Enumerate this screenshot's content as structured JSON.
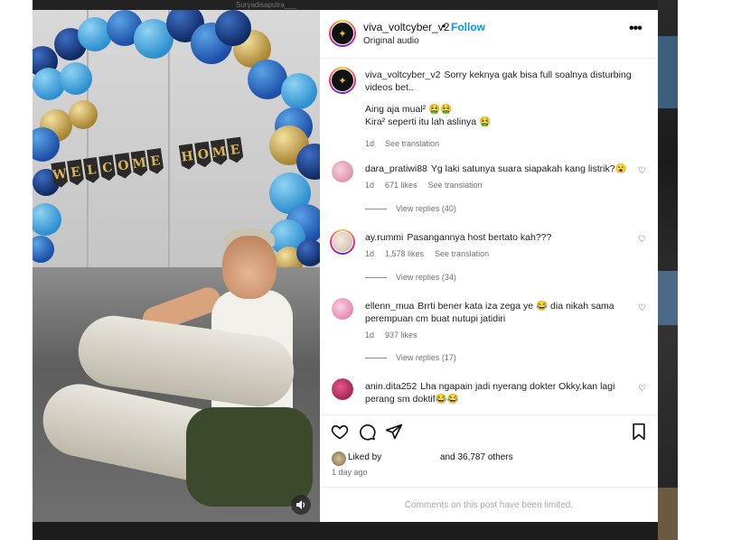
{
  "top_strip": {
    "faint_text": "Suryadisaputra___"
  },
  "post": {
    "author": "viva_voltcyber_v2",
    "follow_label": "Follow",
    "separator": "•",
    "audio_label": "Original audio",
    "more_icon": "more-options-icon"
  },
  "caption": {
    "username": "viva_voltcyber_v2",
    "line1": "Sorry keknya gak bisa full soalnya disturbing videos bet..",
    "line2": "Aing aja mual² 🤮🤮",
    "line3": "Kira² seperti itu lah aslinya 🤮",
    "time": "1d",
    "translate": "See translation"
  },
  "comments": [
    {
      "username": "dara_pratiwi88",
      "text": "Yg laki satunya suara siapakah kang listrik?😮",
      "time": "1d",
      "likes": "671 likes",
      "translate": "See translation",
      "replies": "View replies (40)",
      "avatar_color": "#f1a8b8"
    },
    {
      "username": "ay.rummi",
      "text": "Pasangannya host bertato kah???",
      "time": "1d",
      "likes": "1,578 likes",
      "translate": "See translation",
      "replies": "View replies (34)",
      "avatar_color": "#e8d8c8"
    },
    {
      "username": "ellenn_mua",
      "text": "Brrti bener kata iza zega ye 😂 dia nikah sama perempuan cm buat nutupi jatidiri",
      "time": "1d",
      "likes": "937 likes",
      "translate": "",
      "replies": "View replies (17)",
      "avatar_color": "#f4a0c0"
    },
    {
      "username": "anin.dita252",
      "text": "Lha ngapain jadi nyerang dokter Okky,kan lagi perang sm doktif😂😂",
      "time": "",
      "likes": "",
      "translate": "",
      "replies": "",
      "avatar_color": "#c2185b"
    }
  ],
  "actions": {
    "like_icon": "heart-icon",
    "comment_icon": "comment-icon",
    "share_icon": "send-icon",
    "save_icon": "bookmark-icon",
    "liked_by_label": "Liked by",
    "liked_count": "and 36,787 others",
    "timestamp": "1 day ago"
  },
  "footer": {
    "limited_text": "Comments on this post have been limited."
  },
  "video": {
    "mute_icon": "volume-icon",
    "banner_text": "WELCOMEHOME"
  }
}
